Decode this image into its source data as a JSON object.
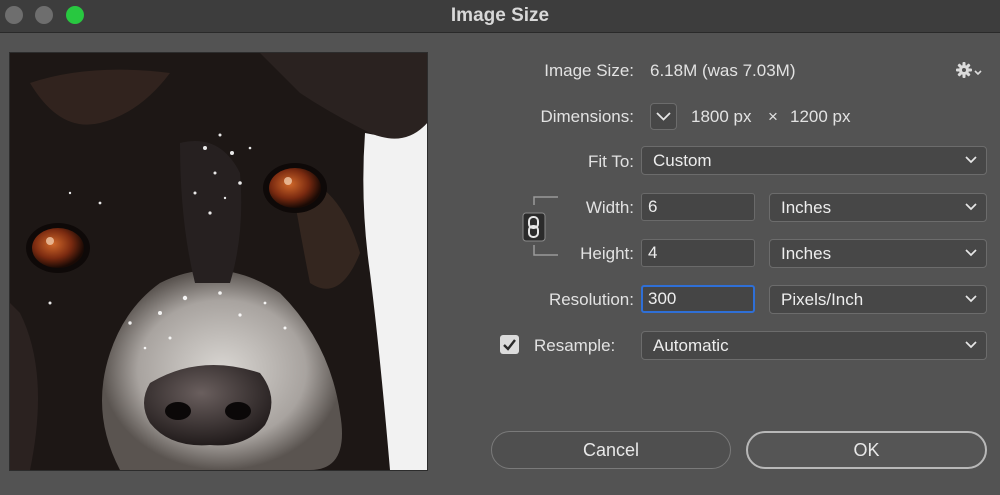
{
  "window": {
    "title": "Image Size"
  },
  "info": {
    "image_size_label": "Image Size:",
    "image_size_value": "6.18M (was 7.03M)",
    "dimensions_label": "Dimensions:",
    "dimensions_width": "1800 px",
    "dimensions_sep": "×",
    "dimensions_height": "1200 px"
  },
  "fit_to": {
    "label": "Fit To:",
    "value": "Custom"
  },
  "width": {
    "label": "Width:",
    "value": "6",
    "unit": "Inches"
  },
  "height": {
    "label": "Height:",
    "value": "4",
    "unit": "Inches"
  },
  "resolution": {
    "label": "Resolution:",
    "value": "300",
    "unit": "Pixels/Inch"
  },
  "resample": {
    "label": "Resample:",
    "checked": true,
    "value": "Automatic"
  },
  "buttons": {
    "cancel": "Cancel",
    "ok": "OK"
  },
  "colors": {
    "dialog_bg": "#535353",
    "focus_ring": "#2f6fd6",
    "zoom_button": "#28c840"
  }
}
